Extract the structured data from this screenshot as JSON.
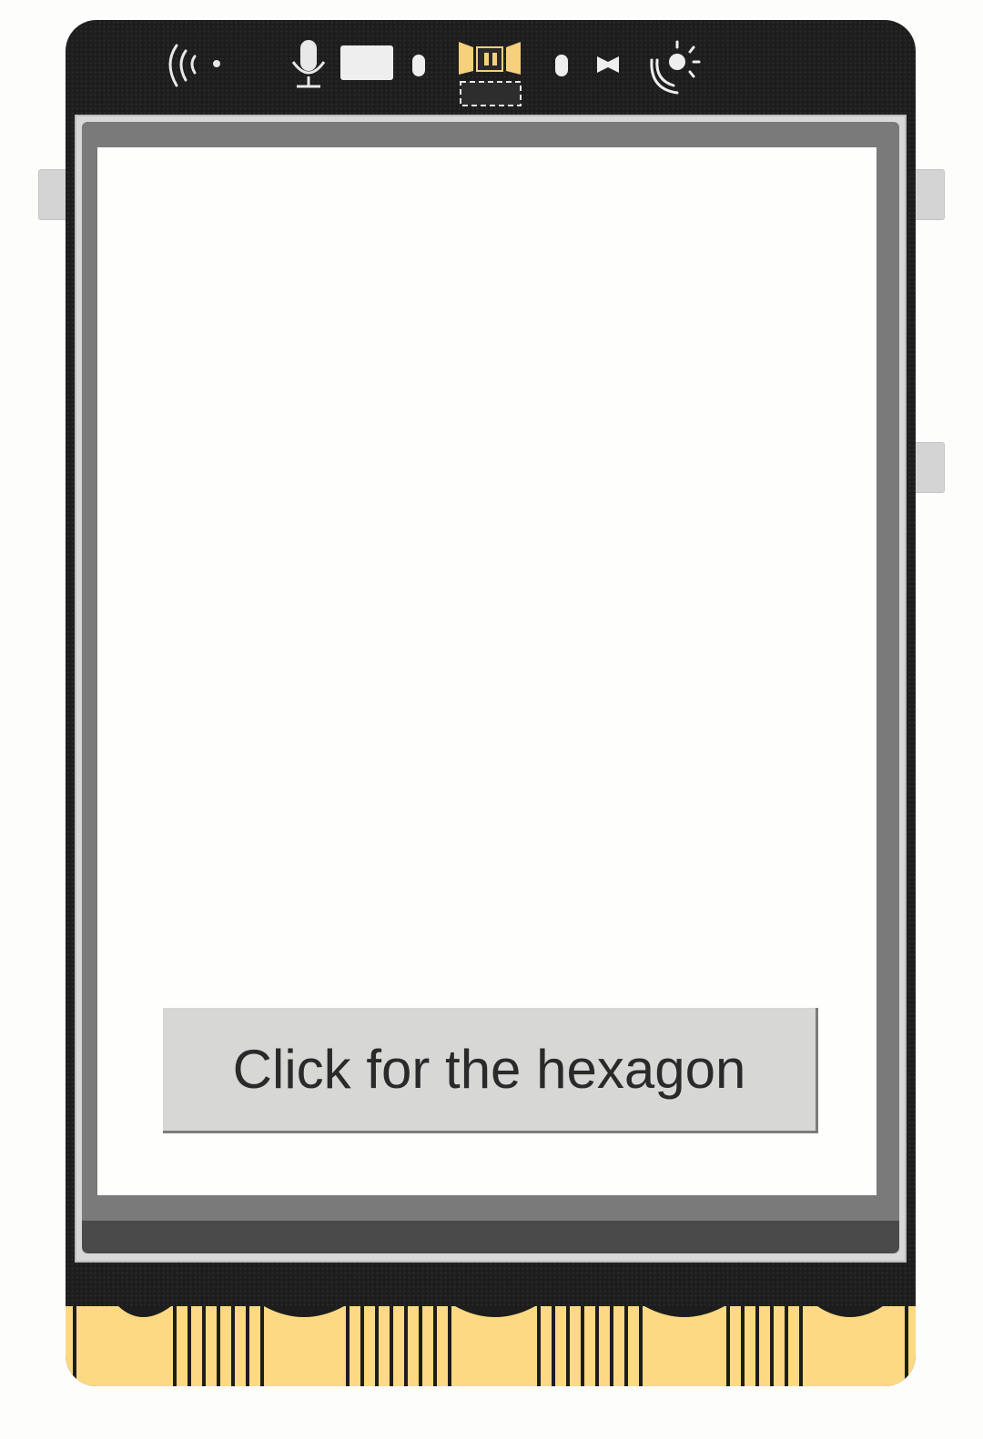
{
  "device": {
    "name": "micro-controller board with lcd screen",
    "icons": [
      "wireless-signal-icon",
      "microphone-icon",
      "light-sensor-icon",
      "buzzer-icon",
      "led-icon",
      "button-icon",
      "sun-brightness-icon"
    ],
    "colors": {
      "board": "#1d1d1d",
      "gold_pins": "#fcd982",
      "bezel": "#7a7a7a",
      "screen": "#fefefd",
      "button_bg": "#d7d8d6"
    }
  },
  "screen": {
    "button_label": "Click for the hexagon"
  }
}
